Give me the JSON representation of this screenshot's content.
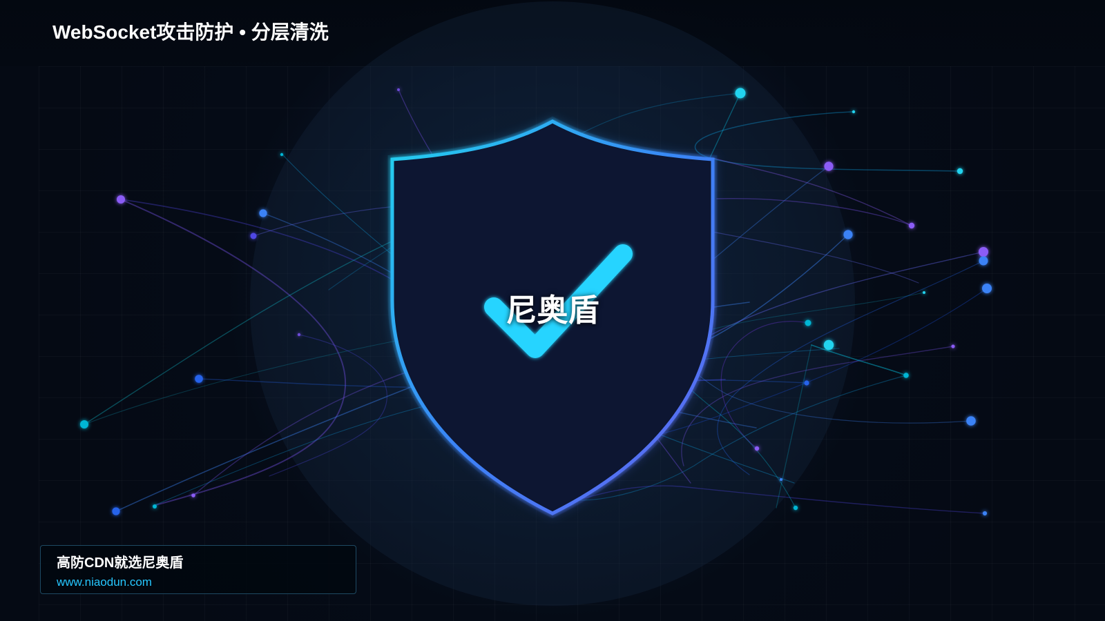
{
  "header": {
    "title": "WebSocket攻击防护 • 分层清洗"
  },
  "hero": {
    "brand_name": "尼奥盾",
    "shield_icon": "shield-icon",
    "checkmark_icon": "checkmark-icon"
  },
  "footer_card": {
    "headline": "高防CDN就选尼奥盾",
    "website": "www.niaodun.com"
  },
  "colors": {
    "background": "#050a14",
    "shield_fill": "#0b1831",
    "shield_stroke_start": "#22d3ee",
    "shield_stroke_end": "#6366f1",
    "checkmark": "#26d4ff",
    "title": "#ffffff",
    "link": "#26c7ff",
    "network_cyan": "#16c7e8",
    "network_blue": "#3b82f6",
    "network_purple": "#8b5cf6"
  }
}
